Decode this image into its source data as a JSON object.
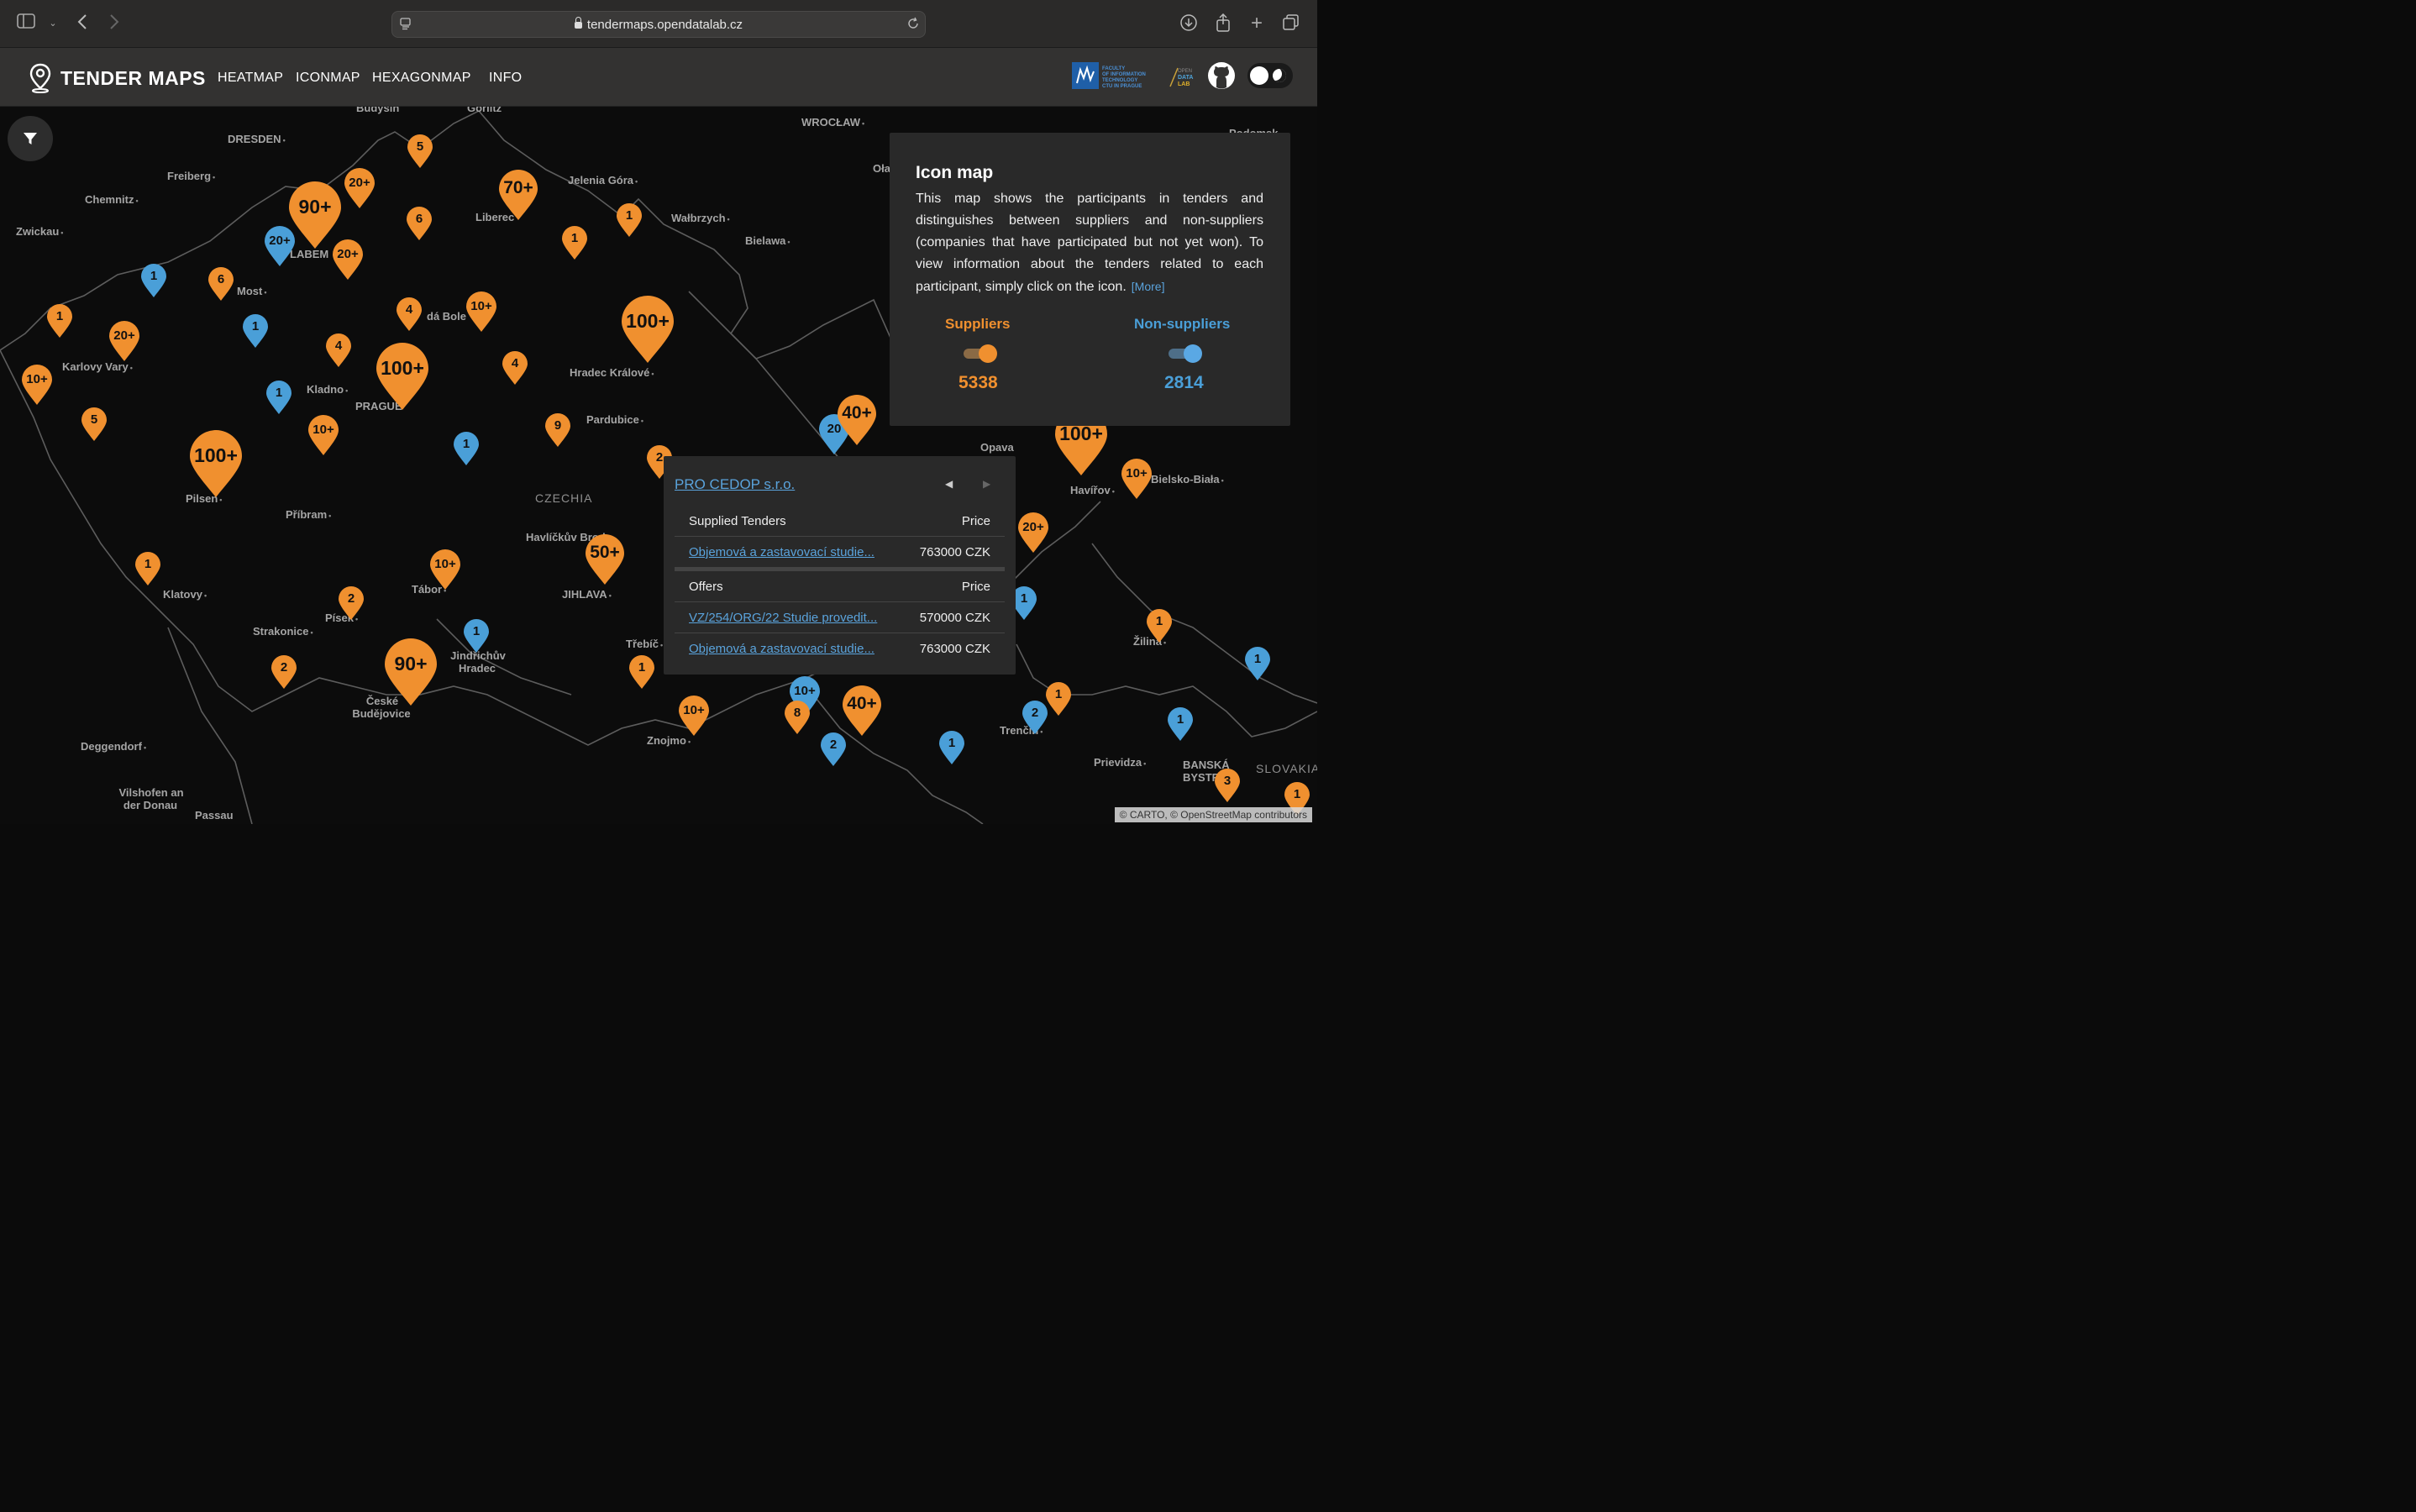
{
  "browser": {
    "url": "tendermaps.opendatalab.cz"
  },
  "header": {
    "brand": "TENDER MAPS",
    "nav": [
      "HEATMAP",
      "ICONMAP",
      "HEXAGONMAP",
      "INFO"
    ],
    "logo_text_1": "FACULTY OF INFORMATION TECHNOLOGY CTU IN PRAGUE",
    "logo_text_2": "OPEN DATA LAB"
  },
  "colors": {
    "supplier": "#f0902f",
    "non_supplier": "#4a9fd8",
    "panel_bg": "#292929",
    "link": "#5aa3dc"
  },
  "map": {
    "cities": [
      "Budyšin",
      "Görlitz",
      "DRESDEN",
      "WROCŁAW",
      "Freiberg",
      "Chemnitz",
      "Zwickau",
      "Jelenia Góra",
      "Liberec",
      "Wałbrzych",
      "Bielawa",
      "Most",
      "LABEM",
      "dá Bole",
      "Karlovy Vary",
      "Kladno",
      "PRAGUE",
      "Hradec Králové",
      "Pardubice",
      "Pilsen",
      "Příbram",
      "CZECHIA",
      "Havlíčkův Brod",
      "JIHLAVA",
      "Tábor",
      "Klatovy",
      "Písek",
      "Strakonice",
      "Jindřichův Hradec",
      "České Budějovice",
      "Třebíč",
      "Znojmo",
      "Deggendorf",
      "Vilshofen an der Donau",
      "Passau",
      "Opava",
      "Havířov",
      "Bielsko-Biała",
      "Žilina",
      "Trenčín",
      "Prievidza",
      "BANSKÁ BYSTR",
      "SLOVAKIA",
      "Oła",
      "Podomsk"
    ],
    "filter_label": "filter",
    "attribution": "© CARTO, © OpenStreetMap contributors",
    "markers_orange": [
      {
        "label": "5"
      },
      {
        "label": "70+"
      },
      {
        "label": "20+"
      },
      {
        "label": "90+"
      },
      {
        "label": "6"
      },
      {
        "label": "20+"
      },
      {
        "label": "1"
      },
      {
        "label": "1"
      },
      {
        "label": "6"
      },
      {
        "label": "1"
      },
      {
        "label": "20+"
      },
      {
        "label": "4"
      },
      {
        "label": "10+"
      },
      {
        "label": "100+"
      },
      {
        "label": "4"
      },
      {
        "label": "100+"
      },
      {
        "label": "4"
      },
      {
        "label": "10+"
      },
      {
        "label": "5"
      },
      {
        "label": "10+"
      },
      {
        "label": "100+"
      },
      {
        "label": "9"
      },
      {
        "label": "2"
      },
      {
        "label": "1"
      },
      {
        "label": "10+"
      },
      {
        "label": "50+"
      },
      {
        "label": "2"
      },
      {
        "label": "2"
      },
      {
        "label": "90+"
      },
      {
        "label": "1"
      },
      {
        "label": "10+"
      },
      {
        "label": "8"
      },
      {
        "label": "40+"
      },
      {
        "label": "40+"
      },
      {
        "label": "100+"
      },
      {
        "label": "10+"
      },
      {
        "label": "20+"
      },
      {
        "label": "1"
      },
      {
        "label": "1"
      },
      {
        "label": "3"
      },
      {
        "label": "1"
      }
    ],
    "markers_blue": [
      {
        "label": "20+"
      },
      {
        "label": "1"
      },
      {
        "label": "1"
      },
      {
        "label": "1"
      },
      {
        "label": "1"
      },
      {
        "label": "1"
      },
      {
        "label": "20"
      },
      {
        "label": "1"
      },
      {
        "label": "2"
      },
      {
        "label": "2"
      },
      {
        "label": "1"
      },
      {
        "label": "1"
      },
      {
        "label": "1"
      },
      {
        "label": "10+"
      }
    ]
  },
  "info": {
    "title": "Icon map",
    "text": "This map shows the participants in tenders and distinguishes between suppliers and non-suppliers (companies that have participated but not yet won). To view information about the tenders related to each participant, simply click on the icon.",
    "more": "[More]",
    "suppliers_label": "Suppliers",
    "suppliers_count": "5338",
    "nonsuppliers_label": "Non-suppliers",
    "nonsuppliers_count": "2814"
  },
  "popup": {
    "company": "PRO CEDOP s.r.o.",
    "supplied_header": "Supplied Tenders",
    "price_header": "Price",
    "supplied": [
      {
        "name": "Objemová a zastavovací studie...",
        "price": "763000 CZK"
      }
    ],
    "offers_header": "Offers",
    "offers": [
      {
        "name": "VZ/254/ORG/22 Studie provedit...",
        "price": "570000 CZK"
      },
      {
        "name": "Objemová a zastavovací studie...",
        "price": "763000 CZK"
      }
    ]
  }
}
